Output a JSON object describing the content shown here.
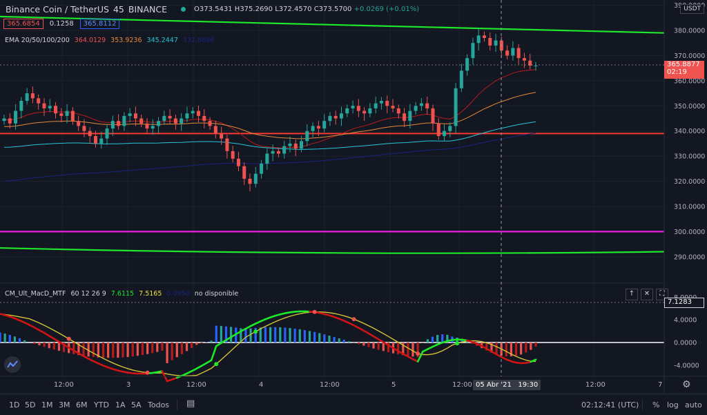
{
  "header": {
    "symbol": "Binance Coin / TetherUS",
    "interval": "45",
    "exchange": "BINANCE",
    "open": "O373.5431",
    "high": "H375.2690",
    "low": "L372.4570",
    "close": "C373.5700",
    "change": "+0.0269 (+0.01%)"
  },
  "boxes": {
    "bid": "365.6854",
    "spread": "0.1258",
    "ask": "365.8112"
  },
  "ema": {
    "label": "EMA 20/50/100/200",
    "v20": "364.0129",
    "v50": "353.9236",
    "v100": "345.2447",
    "v200": "332.8686"
  },
  "indicator": {
    "name": "CM_Ult_MacD_MTF",
    "params": "60 12 26 9",
    "macd": "7.6115",
    "signal": "7.5165",
    "hist": "0.0950",
    "status": "no disponible"
  },
  "price_axis": {
    "currency": "USDT",
    "labels": [
      "390.0000",
      "380.0000",
      "370.0000",
      "360.0000",
      "350.0000",
      "340.0000",
      "330.0000",
      "320.0000",
      "310.0000",
      "300.0000",
      "290.0000"
    ],
    "last_price": "365.8877",
    "countdown": "02:19"
  },
  "macd_axis": {
    "labels": [
      "8.0000",
      "4.0000",
      "0.0000",
      "-4.0000"
    ],
    "current": "7.1283"
  },
  "time_axis": {
    "labels": [
      "12:00",
      "3",
      "12:00",
      "4",
      "12:00",
      "5",
      "12:00",
      "12:00",
      "7"
    ],
    "crosshair_date": "05 Abr '21",
    "crosshair_time": "19:30"
  },
  "colors": {
    "bg": "#131722",
    "up": "#26a69a",
    "down": "#ef5350",
    "green_line": "#1ee82a",
    "red_line": "#ff3b30",
    "magenta_line": "#e91ee0",
    "ema20": "#b71c1c",
    "ema50": "#e6893a",
    "ema100": "#26c6da",
    "ema200": "#1a237e"
  },
  "bottom_bar": {
    "ranges": [
      "1D",
      "5D",
      "1M",
      "3M",
      "6M",
      "YTD",
      "1A",
      "5A",
      "Todos"
    ],
    "clock": "02:12:41 (UTC)",
    "percent": "%",
    "log": "log",
    "auto": "auto"
  },
  "chart_data": {
    "type": "candlestick",
    "ylim": [
      285,
      391
    ],
    "horizontal_lines": [
      {
        "price": 339
      },
      {
        "price": 300
      }
    ],
    "channel_upper": {
      "start": 385.5,
      "end": 379
    },
    "channel_lower": {
      "start": 293.5,
      "min": 290,
      "end": 292
    },
    "candle_closes": [
      345,
      343,
      348,
      352,
      355,
      353,
      351,
      349,
      350,
      347,
      346,
      348,
      344,
      342,
      340,
      338,
      335,
      337,
      341,
      344,
      342,
      346,
      347,
      345,
      343,
      341,
      342,
      344,
      346,
      345,
      343,
      345,
      347,
      348,
      346,
      344,
      342,
      339,
      337,
      332,
      329,
      326,
      321,
      319,
      323,
      327,
      331,
      332,
      331,
      334,
      335,
      333,
      336,
      340,
      342,
      341,
      344,
      346,
      345,
      347,
      349,
      350,
      348,
      347,
      349,
      351,
      352,
      350,
      349,
      347,
      344,
      348,
      350,
      351,
      349,
      343,
      338,
      340,
      342,
      357,
      364,
      369,
      375,
      378,
      377,
      374,
      376,
      372,
      370,
      373,
      369,
      368,
      366,
      366
    ]
  }
}
